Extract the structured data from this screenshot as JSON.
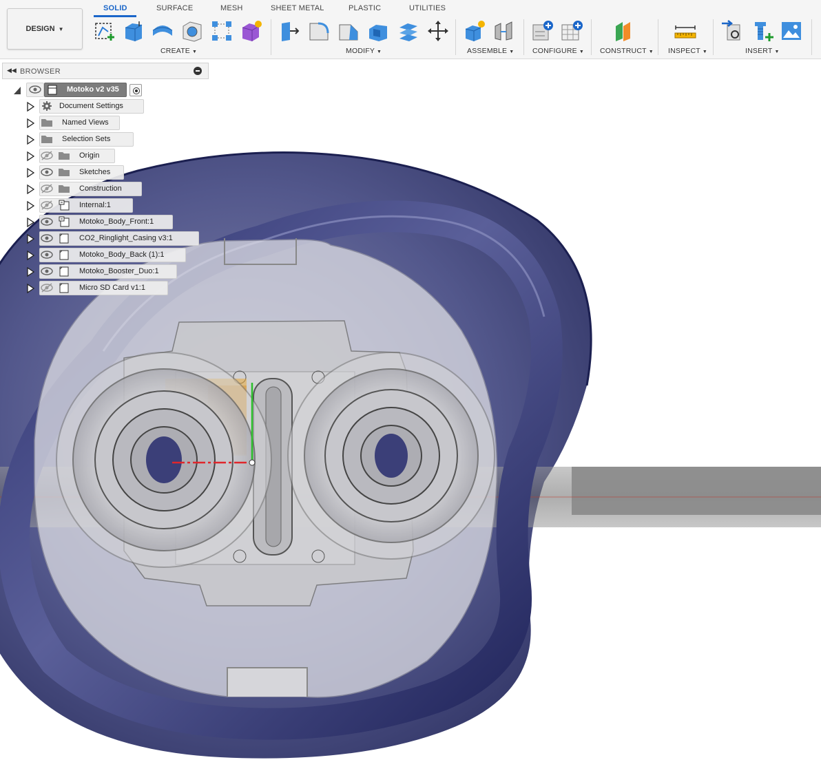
{
  "workspace": {
    "mode_button_label": "DESIGN",
    "tabs": [
      {
        "label": "SOLID",
        "active": true
      },
      {
        "label": "SURFACE",
        "active": false
      },
      {
        "label": "MESH",
        "active": false
      },
      {
        "label": "SHEET METAL",
        "active": false
      },
      {
        "label": "PLASTIC",
        "active": false
      },
      {
        "label": "UTILITIES",
        "active": false
      }
    ],
    "accent_color": "#1a66c9"
  },
  "toolbar": {
    "groups": [
      {
        "label": "CREATE",
        "tools": [
          "create-sketch-icon",
          "extrude-icon",
          "revolve-icon",
          "hole-icon",
          "rectangular-pattern-icon",
          "create-form-icon"
        ]
      },
      {
        "label": "MODIFY",
        "tools": [
          "press-pull-icon",
          "fillet-icon",
          "chamfer-icon",
          "shell-icon",
          "scale-icon",
          "move-icon"
        ]
      },
      {
        "label": "ASSEMBLE",
        "tools": [
          "new-component-icon",
          "joint-icon"
        ]
      },
      {
        "label": "CONFIGURE",
        "tools": [
          "configure-icon",
          "configure-table-icon"
        ]
      },
      {
        "label": "CONSTRUCT",
        "tools": [
          "offset-plane-icon"
        ]
      },
      {
        "label": "INSPECT",
        "tools": [
          "measure-icon"
        ]
      },
      {
        "label": "INSERT",
        "tools": [
          "insert-derive-icon",
          "insert-mcmaster-icon",
          "insert-canvas-icon"
        ]
      }
    ]
  },
  "browser": {
    "title": "BROWSER",
    "root": {
      "label": "Motoko v2 v35",
      "expanded": true,
      "visible": true
    },
    "items": [
      {
        "label": "Document Settings",
        "icon": "gear-icon",
        "eye": "none"
      },
      {
        "label": "Named Views",
        "icon": "folder-icon",
        "eye": "none"
      },
      {
        "label": "Selection Sets",
        "icon": "folder-icon",
        "eye": "none"
      },
      {
        "label": "Origin",
        "icon": "folder-icon",
        "eye": "hidden"
      },
      {
        "label": "Sketches",
        "icon": "folder-icon",
        "eye": "visible"
      },
      {
        "label": "Construction",
        "icon": "folder-icon",
        "eye": "hidden"
      },
      {
        "label": "Internal:1",
        "icon": "linked-component-icon",
        "eye": "hidden"
      },
      {
        "label": "Motoko_Body_Front:1",
        "icon": "linked-component-icon",
        "eye": "visible"
      },
      {
        "label": "CO2_Ringlight_Casing v3:1",
        "icon": "component-icon",
        "eye": "visible"
      },
      {
        "label": "Motoko_Body_Back (1):1",
        "icon": "component-icon",
        "eye": "visible"
      },
      {
        "label": "Motoko_Booster_Duo:1",
        "icon": "component-icon",
        "eye": "visible"
      },
      {
        "label": "Micro SD Card v1:1",
        "icon": "component-icon",
        "eye": "hidden"
      }
    ]
  },
  "viewport": {
    "body_color": "#3a3f7a",
    "casing_color": "#dcdcde",
    "highlight_color": "#e8a93a"
  }
}
